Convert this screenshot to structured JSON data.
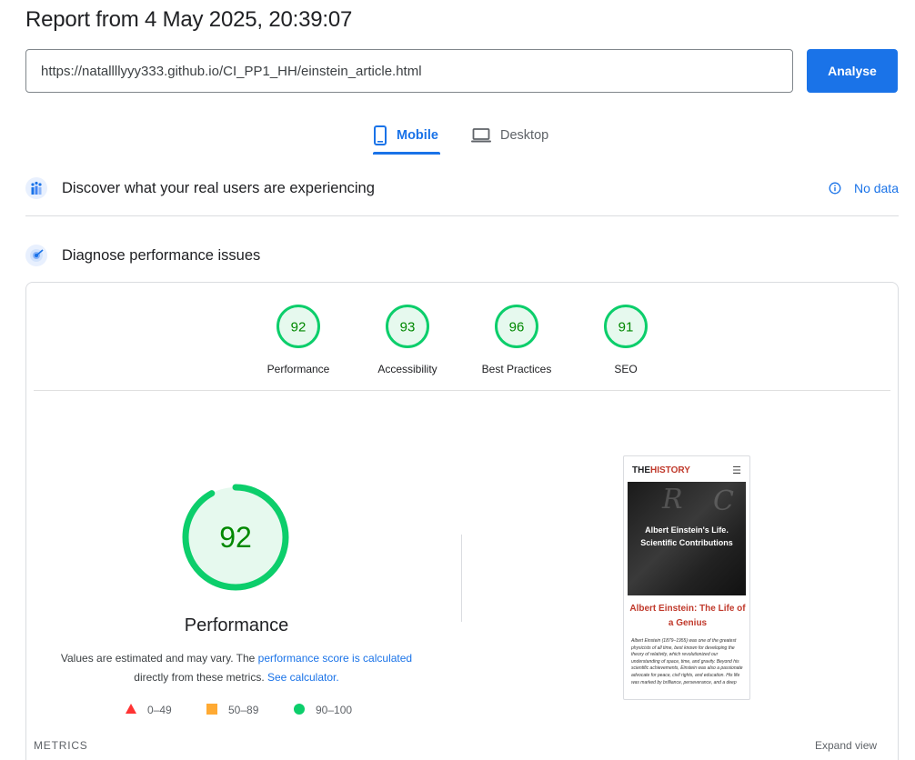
{
  "report": {
    "title": "Report from 4 May 2025, 20:39:07"
  },
  "search": {
    "url": "https://natallllyyy333.github.io/CI_PP1_HH/einstein_article.html",
    "button_label": "Analyse"
  },
  "tabs": [
    {
      "label": "Mobile",
      "icon": "smartphone-icon",
      "active": true
    },
    {
      "label": "Desktop",
      "icon": "laptop-icon",
      "active": false
    }
  ],
  "field_data": {
    "title": "Discover what your real users are experiencing",
    "status": "No data",
    "icon": "crux-icon"
  },
  "lab_data": {
    "title": "Diagnose performance issues",
    "icon": "lighthouse-icon"
  },
  "categories": [
    {
      "label": "Performance",
      "score": 92
    },
    {
      "label": "Accessibility",
      "score": 93
    },
    {
      "label": "Best Practices",
      "score": 96
    },
    {
      "label": "SEO",
      "score": 91
    }
  ],
  "performance": {
    "score": 92,
    "label": "Performance",
    "note_prefix": "Values are estimated and may vary. The ",
    "note_link1": "performance score is calculated",
    "note_mid": "directly from these metrics. ",
    "note_link2": "See calculator."
  },
  "legend": [
    {
      "range": "0–49",
      "shape": "triangle",
      "color": "#ff3333"
    },
    {
      "range": "50–89",
      "shape": "square",
      "color": "#ffaa33"
    },
    {
      "range": "90–100",
      "shape": "circle",
      "color": "#0cce6b"
    }
  ],
  "screenshot": {
    "brand_the": "THE",
    "brand_history": "HISTORY",
    "hero_text": "Albert Einstein's Life. Scientific Contributions",
    "heading": "Albert Einstein: The Life of a Genius",
    "body": "Albert Einstein (1879–1955) was one of the greatest physicists of all time, best known for developing the theory of relativity, which revolutionized our understanding of space, time, and gravity. Beyond his scientific achievements, Einstein was also a passionate advocate for peace, civil rights, and education. His life was marked by brilliance, perseverance, and a deep"
  },
  "metrics": {
    "label": "METRICS",
    "expand_label": "Expand view"
  },
  "colors": {
    "accent": "#1a73e8",
    "pass": "#0cce6b",
    "pass_bg": "#e6f9ee",
    "pass_text": "#008800"
  }
}
